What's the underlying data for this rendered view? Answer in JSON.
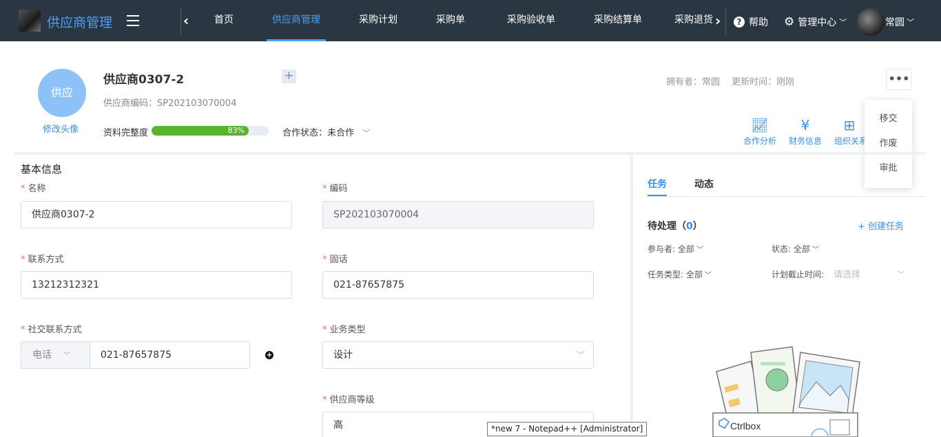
{
  "app": {
    "title": "供应商管理"
  },
  "nav": {
    "tabs": [
      "首页",
      "供应商管理",
      "采购计划",
      "采购单",
      "采购验收单",
      "采购结算单",
      "采购退货"
    ],
    "active_index": 1,
    "help": "帮助",
    "admin_center": "管理中心",
    "user": "常圆"
  },
  "supplier": {
    "avatar_text": "供应",
    "avatar_link": "修改头像",
    "name": "供应商0307-2",
    "code_line": "供应商编码：SP202103070004",
    "completeness_label": "资料完整度",
    "completeness": 83,
    "completeness_text": "83%",
    "coop_status": "合作状态：未合作",
    "owner_text": "拥有者：常圆 　更新时间：刚刚"
  },
  "actions": [
    "合作分析",
    "财务信息",
    "组织关系"
  ],
  "more_menu": [
    "移交",
    "作废",
    "审批"
  ],
  "form": {
    "section_title": "基本信息",
    "name_label": "名称",
    "name_value": "供应商0307-2",
    "code_label": "编码",
    "code_value": "SP202103070004",
    "contact_label": "联系方式",
    "contact_value": "13212312321",
    "landline_label": "固话",
    "landline_value": "021-87657875",
    "social_label": "社交联系方式",
    "social_type": "电话",
    "social_value": "021-87657875",
    "business_label": "业务类型",
    "business_value": "设计",
    "level_label": "供应商等级",
    "level_value": "高"
  },
  "right_panel": {
    "tabs": [
      "任务",
      "动态"
    ],
    "pending_label": "待处理（",
    "pending_count": "0",
    "pending_close": "）",
    "create_task": "+ 创建任务",
    "participants": "参与者: 全部",
    "status": "状态: 全部",
    "task_type": "任务类型: 全部",
    "deadline_label": "计划截止时间:",
    "deadline_placeholder": "请选择",
    "brand": "Ctrlbox"
  },
  "taskbar_tooltip": "*new 7 - Notepad++ [Administrator]",
  "colors": {
    "nav_bg": "#2b3643",
    "accent": "#3a8ee6",
    "progress": "#5ab32d",
    "required": "#f56c6c"
  }
}
